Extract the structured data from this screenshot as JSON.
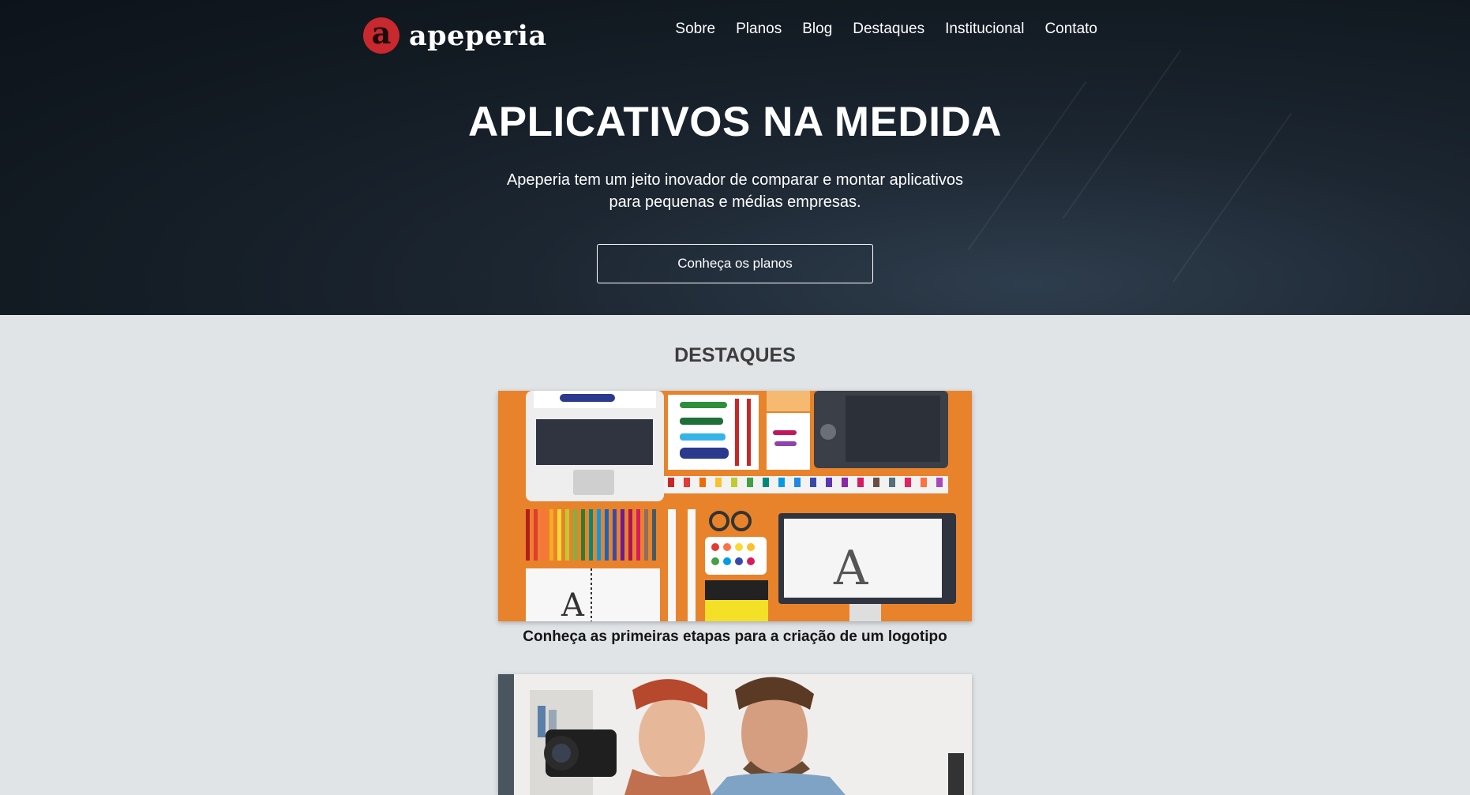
{
  "brand": {
    "mark": "a",
    "name": "apeperia",
    "mark_color": "#c8282e"
  },
  "nav": {
    "items": [
      "Sobre",
      "Planos",
      "Blog",
      "Destaques",
      "Institucional",
      "Contato"
    ]
  },
  "hero": {
    "title": "APLICATIVOS NA MEDIDA",
    "subtitle": "Apeperia tem um jeito inovador de comparar e montar aplicativos para pequenas e médias empresas.",
    "cta_label": "Conheça os planos"
  },
  "highlights": {
    "title": "DESTAQUES",
    "posts": [
      {
        "caption": "Conheça as primeiras etapas para a criação de um logotipo",
        "image": "designer-desk-flatlay"
      },
      {
        "caption": "",
        "image": "photographers-with-camera"
      }
    ]
  },
  "colors": {
    "hero_bg": "#121a22",
    "page_bg": "#e1e4e7",
    "card1_bg": "#e8832c"
  }
}
